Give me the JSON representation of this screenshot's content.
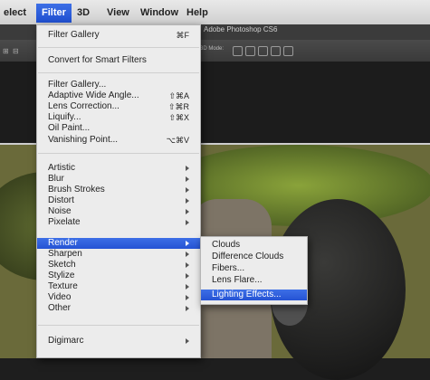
{
  "menubar": {
    "items": [
      "elect",
      "Filter",
      "3D",
      "View",
      "Window",
      "Help"
    ],
    "active_index": 1
  },
  "app": {
    "title": "Adobe Photoshop CS6",
    "options_text": "3D Mode:"
  },
  "filter_menu": {
    "filter_gallery_top": {
      "label": "Filter Gallery",
      "shortcut": "⌘F"
    },
    "convert_smart": "Convert for Smart Filters",
    "group2": [
      {
        "label": "Filter Gallery...",
        "shortcut": ""
      },
      {
        "label": "Adaptive Wide Angle...",
        "shortcut": "⇧⌘A"
      },
      {
        "label": "Lens Correction...",
        "shortcut": "⇧⌘R"
      },
      {
        "label": "Liquify...",
        "shortcut": "⇧⌘X"
      },
      {
        "label": "Oil Paint...",
        "shortcut": ""
      },
      {
        "label": "Vanishing Point...",
        "shortcut": "⌥⌘V"
      }
    ],
    "submenus": [
      "Artistic",
      "Blur",
      "Brush Strokes",
      "Distort",
      "Noise",
      "Pixelate",
      "Render",
      "Sharpen",
      "Sketch",
      "Stylize",
      "Texture",
      "Video",
      "Other"
    ],
    "active_submenu": "Render",
    "digimarc": "Digimarc"
  },
  "render_submenu": {
    "items": [
      "Clouds",
      "Difference Clouds",
      "Fibers...",
      "Lens Flare...",
      "Lighting Effects..."
    ],
    "active_item": "Lighting Effects..."
  }
}
